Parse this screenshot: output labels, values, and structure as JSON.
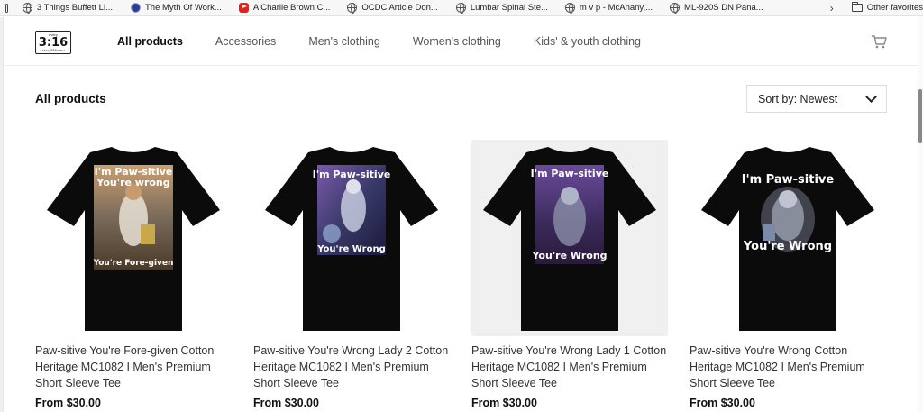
{
  "bookmarks": [
    {
      "label": "3 Things Buffett Li...",
      "icon": "globe-icon"
    },
    {
      "label": "The Myth Of Work...",
      "icon": "site-icon"
    },
    {
      "label": "A Charlie Brown C...",
      "icon": "youtube-icon"
    },
    {
      "label": "OCDC Article  Don...",
      "icon": "globe-icon"
    },
    {
      "label": "Lumbar Spinal Ste...",
      "icon": "globe-icon"
    },
    {
      "label": "m v p - McAnany,...",
      "icon": "globe-icon"
    },
    {
      "label": "ML-920S DN Pana...",
      "icon": "globe-icon"
    }
  ],
  "bookmarks_more": "›",
  "other_favorites": "Other favorites",
  "logo": {
    "top": "every",
    "main": "3:16",
    "bottom": "every316.com"
  },
  "nav": [
    {
      "label": "All products",
      "active": true
    },
    {
      "label": "Accessories",
      "active": false
    },
    {
      "label": "Men's clothing",
      "active": false
    },
    {
      "label": "Women's clothing",
      "active": false
    },
    {
      "label": "Kids' & youth clothing",
      "active": false
    }
  ],
  "page_title": "All products",
  "sort": {
    "label": "Sort by: Newest"
  },
  "products": [
    {
      "name": "Paw-sitive You're Fore-given Cotton Heritage MC1082 I Men's Premium Short Sleeve Tee",
      "price": "From $30.00",
      "print_top": "I'm Paw-sitive",
      "print_top2": "You're wrong",
      "print_bottom": "You're Fore-given"
    },
    {
      "name": "Paw-sitive You're Wrong Lady 2 Cotton Heritage MC1082 I Men's Premium Short Sleeve Tee",
      "price": "From $30.00",
      "print_top": "I'm Paw-sitive",
      "print_top2": "",
      "print_bottom": "You're Wrong"
    },
    {
      "name": "Paw-sitive You're Wrong Lady 1 Cotton Heritage MC1082 I Men's Premium Short Sleeve Tee",
      "price": "From $30.00",
      "print_top": "I'm Paw-sitive",
      "print_top2": "",
      "print_bottom": "You're Wrong"
    },
    {
      "name": "Paw-sitive You're Wrong Cotton Heritage MC1082 I Men's Premium Short Sleeve Tee",
      "price": "From $30.00",
      "print_top": "I'm Paw-sitive",
      "print_top2": "",
      "print_bottom": "You're Wrong"
    }
  ],
  "colors": {
    "shirt": "#0b0b0b",
    "card_shade": "#f0f0f0",
    "print_warm": "#8a6a4a",
    "print_purple": "#5a3a8a"
  }
}
